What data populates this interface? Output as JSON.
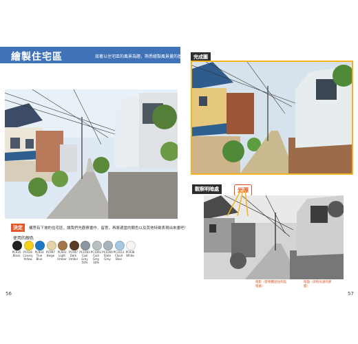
{
  "left_page": {
    "title": "繪製住宅區",
    "intro": "接著以住宅區的風景為題，熟悉繪製風景畫的基本技巧吧！",
    "decision": {
      "tag": "決定",
      "text": "構思有下坡的住宅區，讓我們先觀察畫作、留意，再將適當的顏色以及其他特徵表現出來畫吧！"
    },
    "colors_heading": "使用的顏色",
    "colors": [
      {
        "code": "PC935",
        "name": "Black",
        "hex": "#222222"
      },
      {
        "code": "PC916",
        "name": "Canary Yellow",
        "hex": "#f2d21b"
      },
      {
        "code": "PC903",
        "name": "True Blue",
        "hex": "#1f79c7"
      },
      {
        "code": "PC997",
        "name": "Beige",
        "hex": "#e6d3a8"
      },
      {
        "code": "PC941",
        "name": "Light Umber",
        "hex": "#a4774a"
      },
      {
        "code": "PC947",
        "name": "Dark Umber",
        "hex": "#5b3b22"
      },
      {
        "code": "PC1063 Cool Grey",
        "name": "50%",
        "hex": "#8d979f"
      },
      {
        "code": "PC1061 Cool Grey",
        "name": "30%",
        "hex": "#b8c1c6"
      },
      {
        "code": "PC1069",
        "name": "Slate Grey",
        "hex": "#a7b4bd"
      },
      {
        "code": "PC1023",
        "name": "Cloud Blue",
        "hex": "#a7c8e3"
      },
      {
        "code": "PC938",
        "name": "White",
        "hex": "#f4f4f4"
      }
    ],
    "page_number": "56"
  },
  "right_page": {
    "finished_label": "完成圖",
    "observe_label": "觀察明暗處",
    "light_label": "光源",
    "annotation_1": "暗影（受物體遮住的陰暗處）",
    "annotation_2": "暗面（背對光源的那面）",
    "page_number": "57"
  },
  "colors": {
    "header_blue": "#3f72b7",
    "accent_orange": "#e35829",
    "frame_yellow": "#f5b21b"
  }
}
